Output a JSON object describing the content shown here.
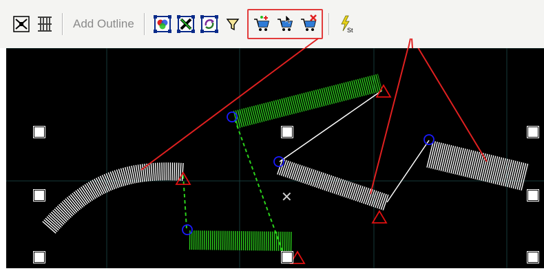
{
  "toolbar": {
    "buttons_left": [
      {
        "name": "compound-outline-icon",
        "tooltip": ""
      },
      {
        "name": "sequence-numbers-icon",
        "tooltip": ""
      }
    ],
    "add_outline_label": "Add Outline",
    "buttons_mid": [
      {
        "name": "select-colors-icon"
      },
      {
        "name": "delete-cross-icon"
      },
      {
        "name": "rotate-refresh-icon"
      },
      {
        "name": "filter-funnel-icon"
      }
    ],
    "highlighted_group": [
      {
        "name": "cart-add-icon"
      },
      {
        "name": "cart-select-icon"
      },
      {
        "name": "cart-remove-icon"
      }
    ],
    "last_button": {
      "name": "lightning-st-icon",
      "label": "St"
    }
  },
  "colors": {
    "highlight_border": "#e23b3b",
    "callout_line": "#e02020",
    "canvas_bg": "#000000",
    "grid": "#163a3a",
    "green_stitch": "#2bd11b",
    "white_stitch": "#ffffff",
    "start_marker": "#1a1aff",
    "end_marker": "#e01010"
  },
  "canvas": {
    "center_marker": "✕"
  }
}
